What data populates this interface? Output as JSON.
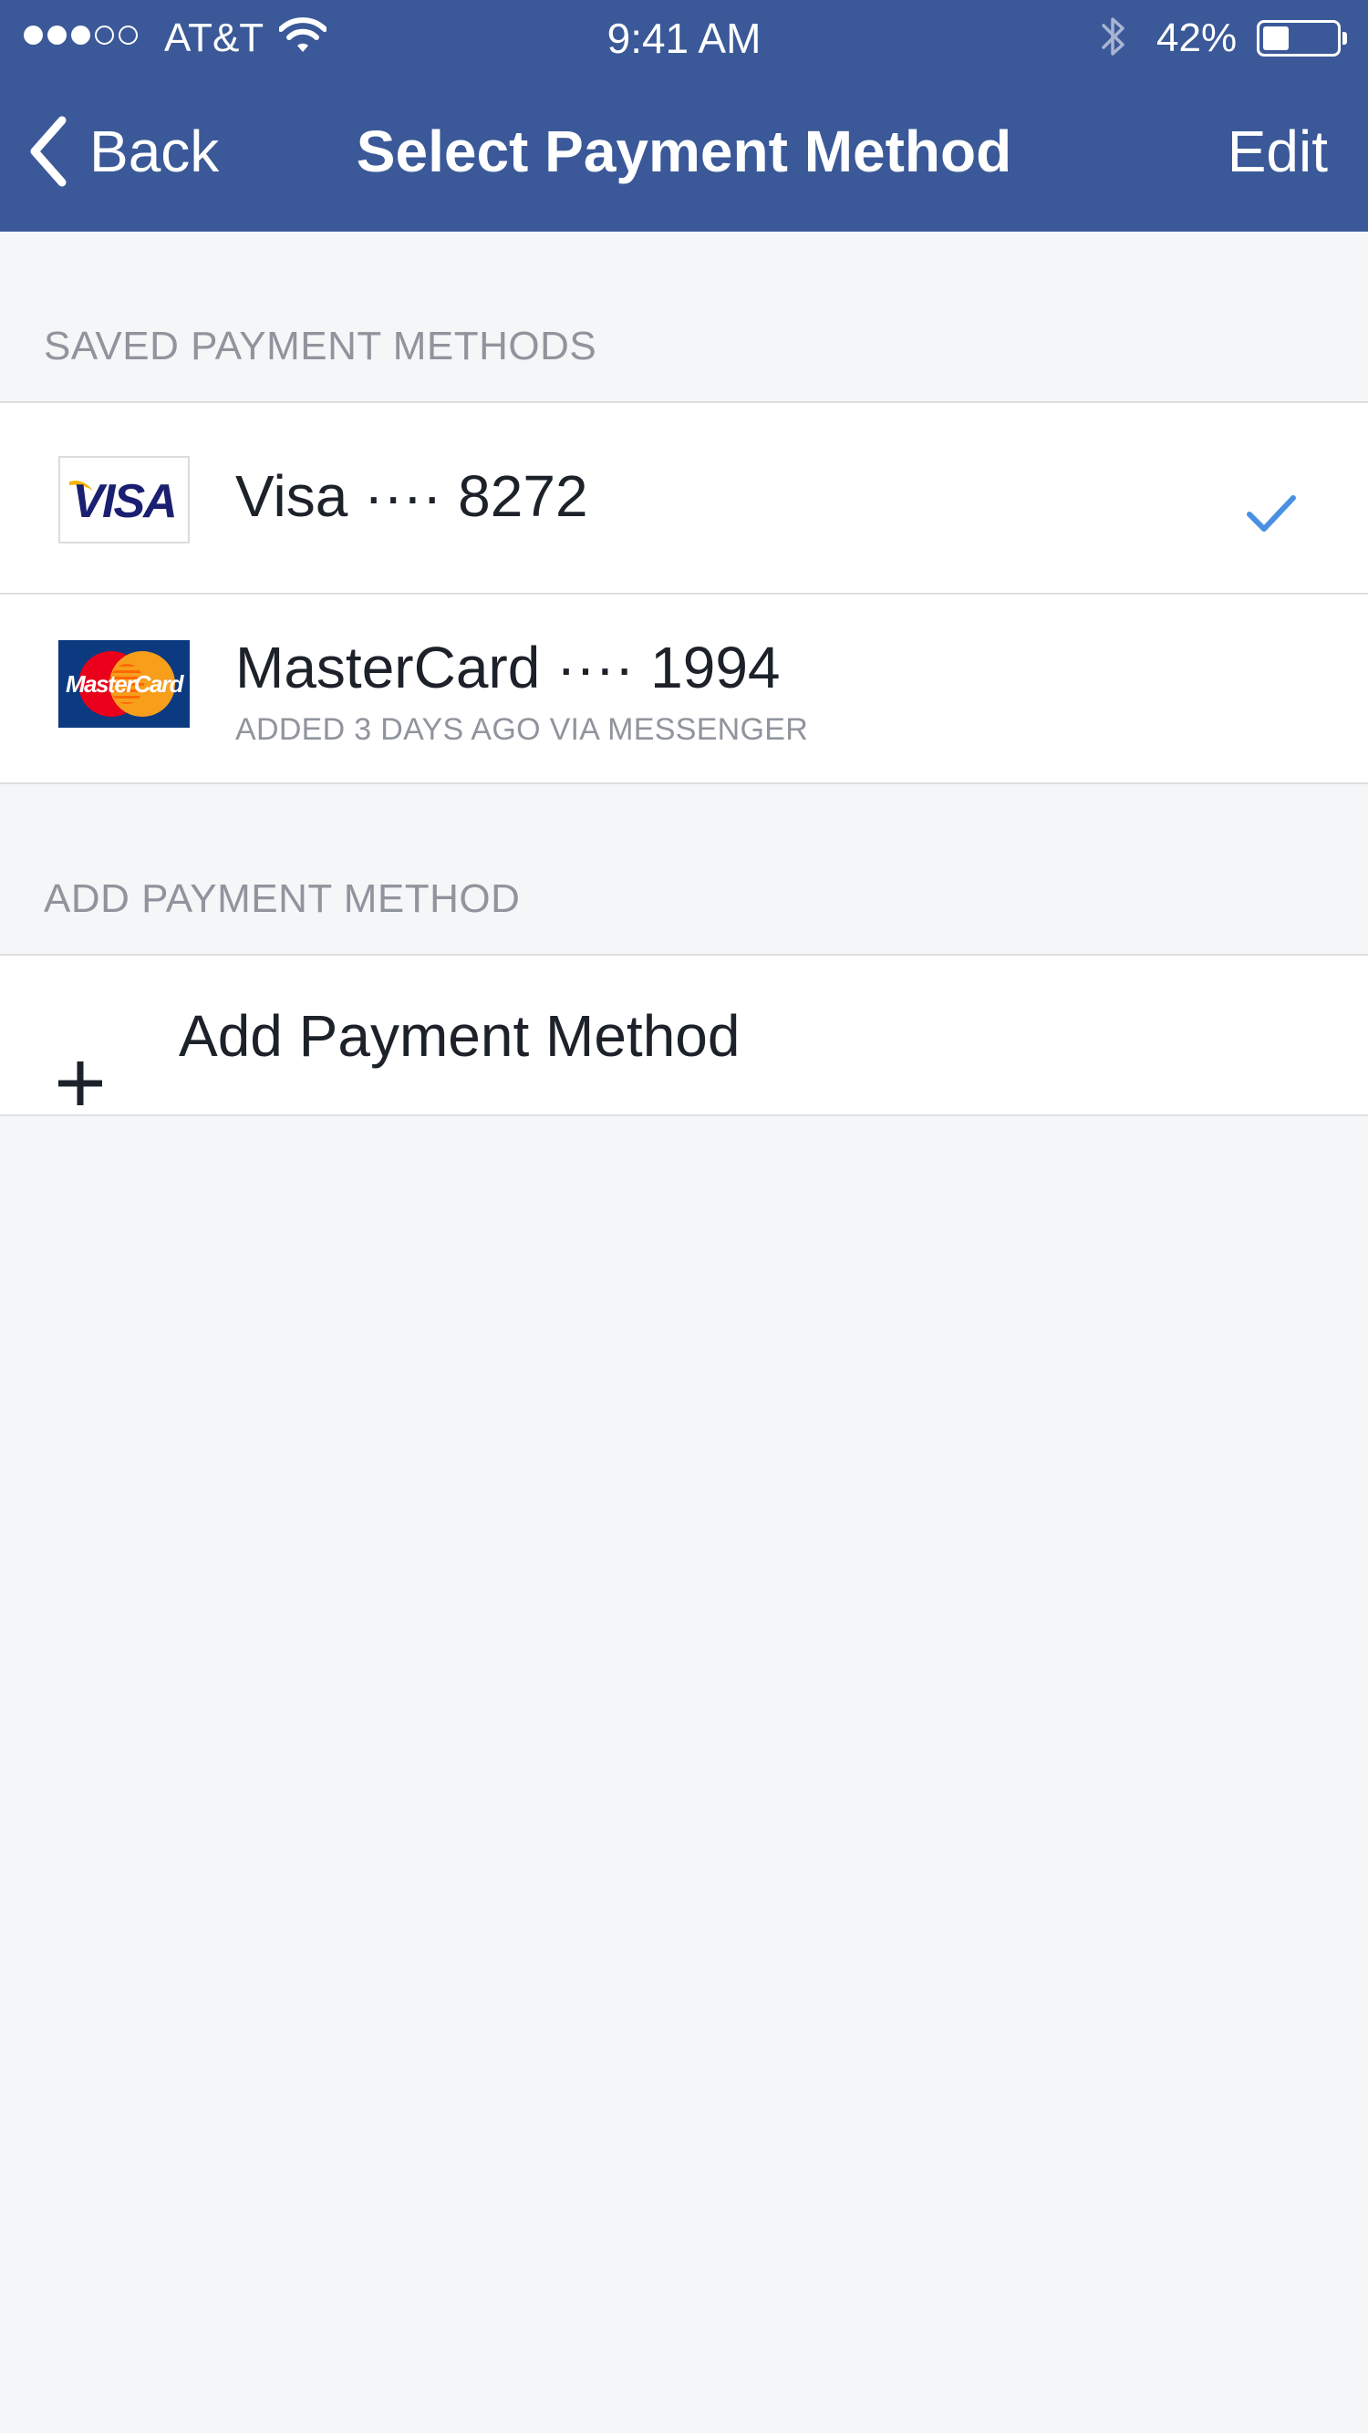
{
  "status_bar": {
    "signal_dots": [
      true,
      true,
      true,
      false,
      false
    ],
    "carrier": "AT&T",
    "wifi_icon": "wifi-icon",
    "time": "9:41 AM",
    "bluetooth_icon": "bluetooth-icon",
    "battery_percent_text": "42%",
    "battery_level": 0.42
  },
  "nav": {
    "back_label": "Back",
    "back_icon": "chevron-left-icon",
    "title": "Select Payment Method",
    "edit_label": "Edit"
  },
  "saved_section": {
    "header": "SAVED PAYMENT METHODS",
    "items": [
      {
        "brand": "VISA",
        "label": "Visa ···· 8272",
        "subtitle": "",
        "selected": true,
        "check_icon": "checkmark-icon"
      },
      {
        "brand": "MasterCard",
        "label": "MasterCard ···· 1994",
        "subtitle": "ADDED 3 DAYS AGO VIA MESSENGER",
        "selected": false
      }
    ]
  },
  "add_section": {
    "header": "ADD PAYMENT METHOD",
    "button_label": "Add Payment Method",
    "icon": "plus-icon"
  },
  "colors": {
    "nav_background": "#3b5998",
    "page_background": "#f5f6f8",
    "section_header_text": "#90949c",
    "check_blue": "#4a90e2",
    "separator": "#dddfe2"
  }
}
